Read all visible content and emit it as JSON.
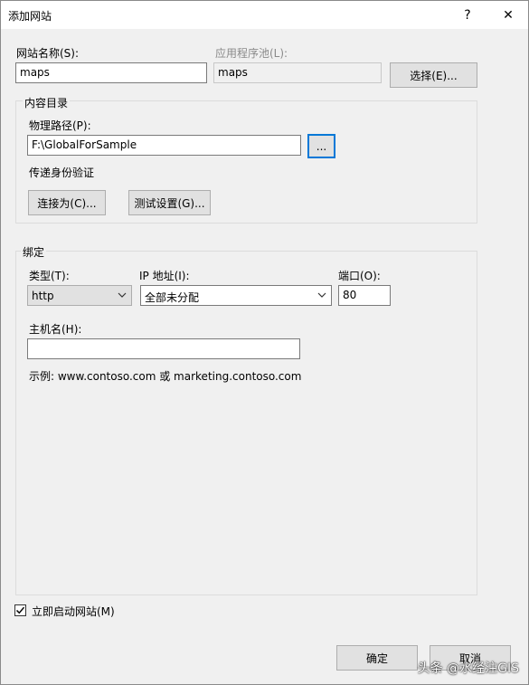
{
  "window": {
    "title": "添加网站",
    "help_glyph": "?",
    "close_glyph": "✕"
  },
  "site": {
    "name_label": "网站名称(S):",
    "name_value": "maps",
    "pool_label": "应用程序池(L):",
    "pool_value": "maps",
    "select_button": "选择(E)..."
  },
  "content_dir": {
    "group_label": "内容目录",
    "physical_path_label": "物理路径(P):",
    "physical_path_value": "F:\\GlobalForSample",
    "browse_button": "...",
    "pass_auth_label": "传递身份验证",
    "connect_as_button": "连接为(C)...",
    "test_settings_button": "测试设置(G)..."
  },
  "binding": {
    "group_label": "绑定",
    "type_label": "类型(T):",
    "type_value": "http",
    "ip_label": "IP 地址(I):",
    "ip_value": "全部未分配",
    "port_label": "端口(O):",
    "port_value": "80",
    "host_label": "主机名(H):",
    "host_value": "",
    "example_text": "示例: www.contoso.com 或 marketing.contoso.com"
  },
  "start_now": {
    "label": "立即启动网站(M)",
    "checked": true
  },
  "footer": {
    "ok_button": "确定",
    "cancel_button": "取消"
  },
  "watermark": "头条 @水经注GIS"
}
